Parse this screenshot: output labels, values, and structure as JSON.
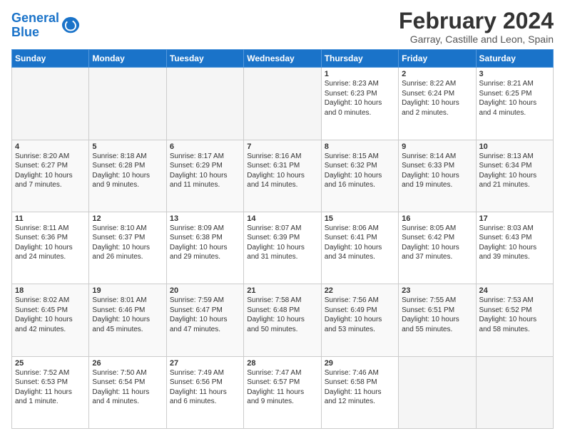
{
  "logo": {
    "line1": "General",
    "line2": "Blue"
  },
  "title": "February 2024",
  "subtitle": "Garray, Castille and Leon, Spain",
  "weekdays": [
    "Sunday",
    "Monday",
    "Tuesday",
    "Wednesday",
    "Thursday",
    "Friday",
    "Saturday"
  ],
  "weeks": [
    [
      {
        "day": "",
        "info": ""
      },
      {
        "day": "",
        "info": ""
      },
      {
        "day": "",
        "info": ""
      },
      {
        "day": "",
        "info": ""
      },
      {
        "day": "1",
        "info": "Sunrise: 8:23 AM\nSunset: 6:23 PM\nDaylight: 10 hours\nand 0 minutes."
      },
      {
        "day": "2",
        "info": "Sunrise: 8:22 AM\nSunset: 6:24 PM\nDaylight: 10 hours\nand 2 minutes."
      },
      {
        "day": "3",
        "info": "Sunrise: 8:21 AM\nSunset: 6:25 PM\nDaylight: 10 hours\nand 4 minutes."
      }
    ],
    [
      {
        "day": "4",
        "info": "Sunrise: 8:20 AM\nSunset: 6:27 PM\nDaylight: 10 hours\nand 7 minutes."
      },
      {
        "day": "5",
        "info": "Sunrise: 8:18 AM\nSunset: 6:28 PM\nDaylight: 10 hours\nand 9 minutes."
      },
      {
        "day": "6",
        "info": "Sunrise: 8:17 AM\nSunset: 6:29 PM\nDaylight: 10 hours\nand 11 minutes."
      },
      {
        "day": "7",
        "info": "Sunrise: 8:16 AM\nSunset: 6:31 PM\nDaylight: 10 hours\nand 14 minutes."
      },
      {
        "day": "8",
        "info": "Sunrise: 8:15 AM\nSunset: 6:32 PM\nDaylight: 10 hours\nand 16 minutes."
      },
      {
        "day": "9",
        "info": "Sunrise: 8:14 AM\nSunset: 6:33 PM\nDaylight: 10 hours\nand 19 minutes."
      },
      {
        "day": "10",
        "info": "Sunrise: 8:13 AM\nSunset: 6:34 PM\nDaylight: 10 hours\nand 21 minutes."
      }
    ],
    [
      {
        "day": "11",
        "info": "Sunrise: 8:11 AM\nSunset: 6:36 PM\nDaylight: 10 hours\nand 24 minutes."
      },
      {
        "day": "12",
        "info": "Sunrise: 8:10 AM\nSunset: 6:37 PM\nDaylight: 10 hours\nand 26 minutes."
      },
      {
        "day": "13",
        "info": "Sunrise: 8:09 AM\nSunset: 6:38 PM\nDaylight: 10 hours\nand 29 minutes."
      },
      {
        "day": "14",
        "info": "Sunrise: 8:07 AM\nSunset: 6:39 PM\nDaylight: 10 hours\nand 31 minutes."
      },
      {
        "day": "15",
        "info": "Sunrise: 8:06 AM\nSunset: 6:41 PM\nDaylight: 10 hours\nand 34 minutes."
      },
      {
        "day": "16",
        "info": "Sunrise: 8:05 AM\nSunset: 6:42 PM\nDaylight: 10 hours\nand 37 minutes."
      },
      {
        "day": "17",
        "info": "Sunrise: 8:03 AM\nSunset: 6:43 PM\nDaylight: 10 hours\nand 39 minutes."
      }
    ],
    [
      {
        "day": "18",
        "info": "Sunrise: 8:02 AM\nSunset: 6:45 PM\nDaylight: 10 hours\nand 42 minutes."
      },
      {
        "day": "19",
        "info": "Sunrise: 8:01 AM\nSunset: 6:46 PM\nDaylight: 10 hours\nand 45 minutes."
      },
      {
        "day": "20",
        "info": "Sunrise: 7:59 AM\nSunset: 6:47 PM\nDaylight: 10 hours\nand 47 minutes."
      },
      {
        "day": "21",
        "info": "Sunrise: 7:58 AM\nSunset: 6:48 PM\nDaylight: 10 hours\nand 50 minutes."
      },
      {
        "day": "22",
        "info": "Sunrise: 7:56 AM\nSunset: 6:49 PM\nDaylight: 10 hours\nand 53 minutes."
      },
      {
        "day": "23",
        "info": "Sunrise: 7:55 AM\nSunset: 6:51 PM\nDaylight: 10 hours\nand 55 minutes."
      },
      {
        "day": "24",
        "info": "Sunrise: 7:53 AM\nSunset: 6:52 PM\nDaylight: 10 hours\nand 58 minutes."
      }
    ],
    [
      {
        "day": "25",
        "info": "Sunrise: 7:52 AM\nSunset: 6:53 PM\nDaylight: 11 hours\nand 1 minute."
      },
      {
        "day": "26",
        "info": "Sunrise: 7:50 AM\nSunset: 6:54 PM\nDaylight: 11 hours\nand 4 minutes."
      },
      {
        "day": "27",
        "info": "Sunrise: 7:49 AM\nSunset: 6:56 PM\nDaylight: 11 hours\nand 6 minutes."
      },
      {
        "day": "28",
        "info": "Sunrise: 7:47 AM\nSunset: 6:57 PM\nDaylight: 11 hours\nand 9 minutes."
      },
      {
        "day": "29",
        "info": "Sunrise: 7:46 AM\nSunset: 6:58 PM\nDaylight: 11 hours\nand 12 minutes."
      },
      {
        "day": "",
        "info": ""
      },
      {
        "day": "",
        "info": ""
      }
    ]
  ]
}
